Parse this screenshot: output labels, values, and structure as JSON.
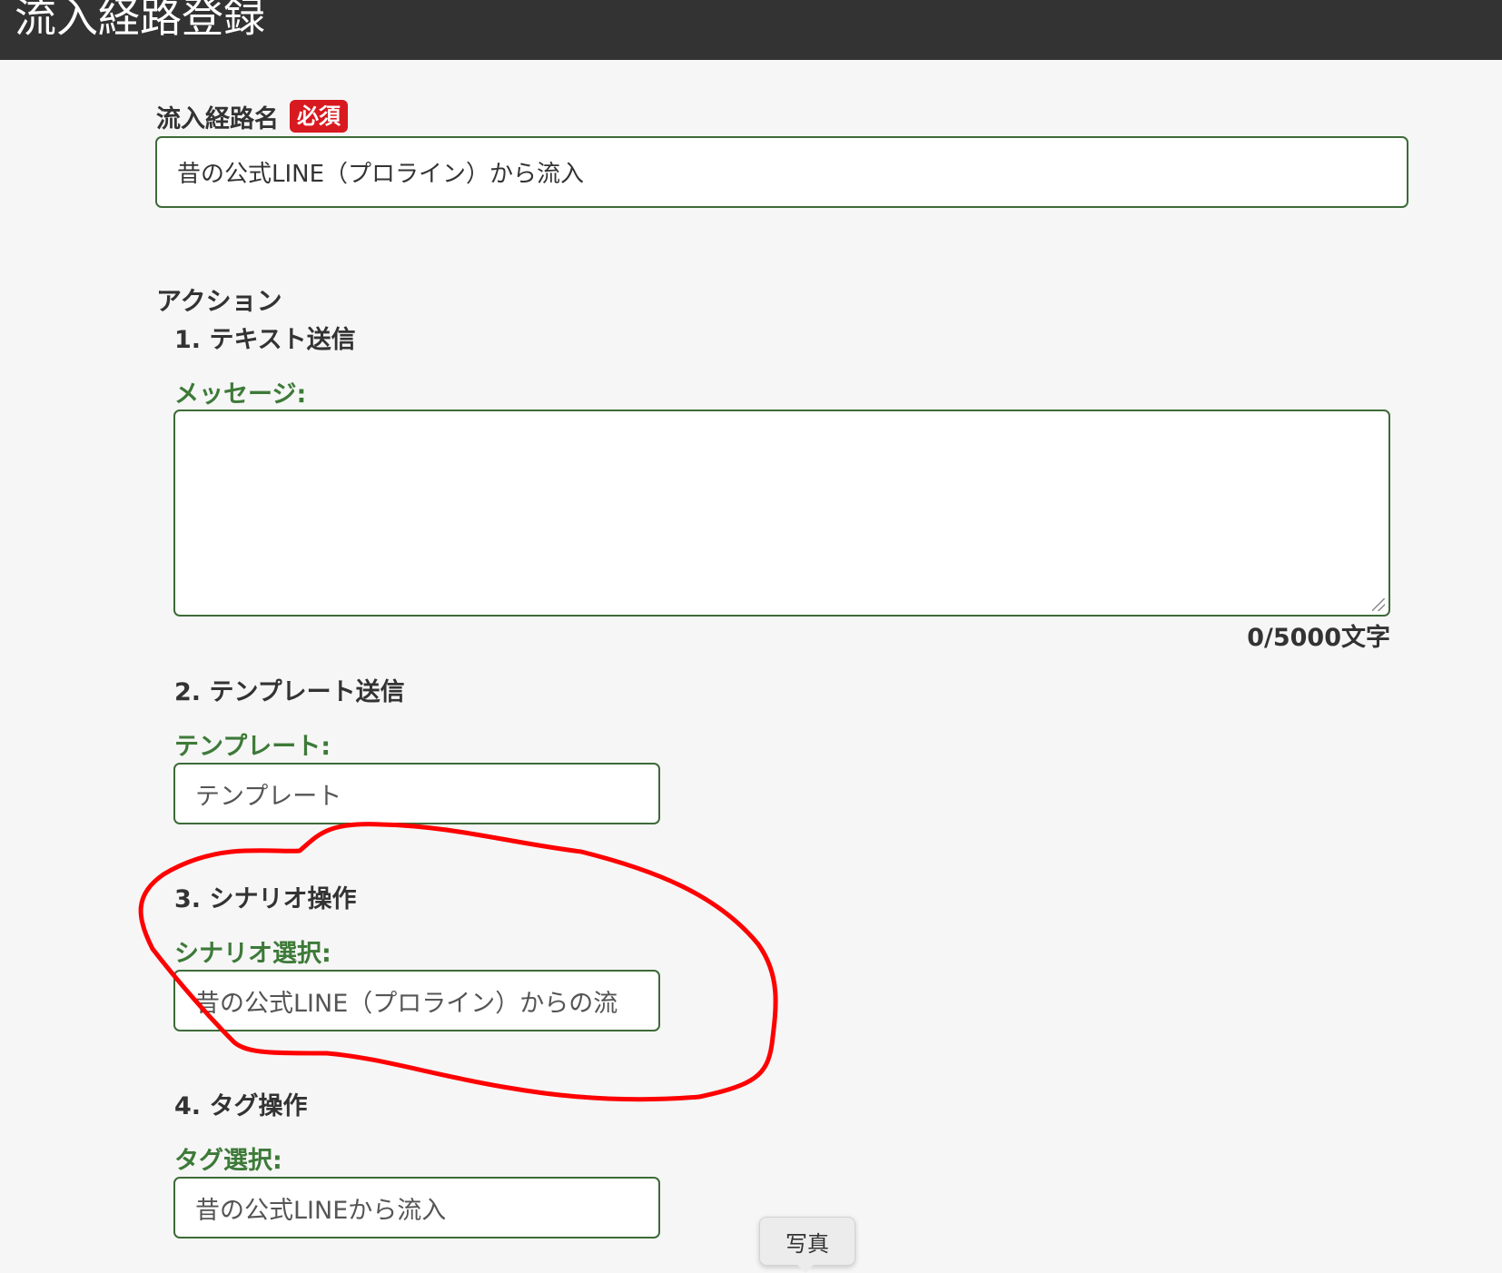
{
  "header": {
    "title": "流入経路登録"
  },
  "form": {
    "name_label": "流入経路名",
    "required_badge": "必須",
    "name_value": "昔の公式LINE（プロライン）から流入",
    "actions_title": "アクション",
    "step1": {
      "title": "1. テキスト送信",
      "message_label": "メッセージ:",
      "message_value": "",
      "counter": "0/5000文字"
    },
    "step2": {
      "title": "2. テンプレート送信",
      "template_label": "テンプレート:",
      "template_placeholder": "テンプレート"
    },
    "step3": {
      "title": "3. シナリオ操作",
      "scenario_label": "シナリオ選択:",
      "scenario_value": "昔の公式LINE（プロライン）からの流"
    },
    "step4": {
      "title": "4. タグ操作",
      "tag_label": "タグ選択:",
      "tag_value": "昔の公式LINEから流入"
    }
  },
  "tooltip": {
    "label": "写真"
  },
  "colors": {
    "header_bg": "#333333",
    "accent_green": "#3d7a38",
    "required_red": "#d8191f",
    "annotation_red": "#ff0000"
  }
}
